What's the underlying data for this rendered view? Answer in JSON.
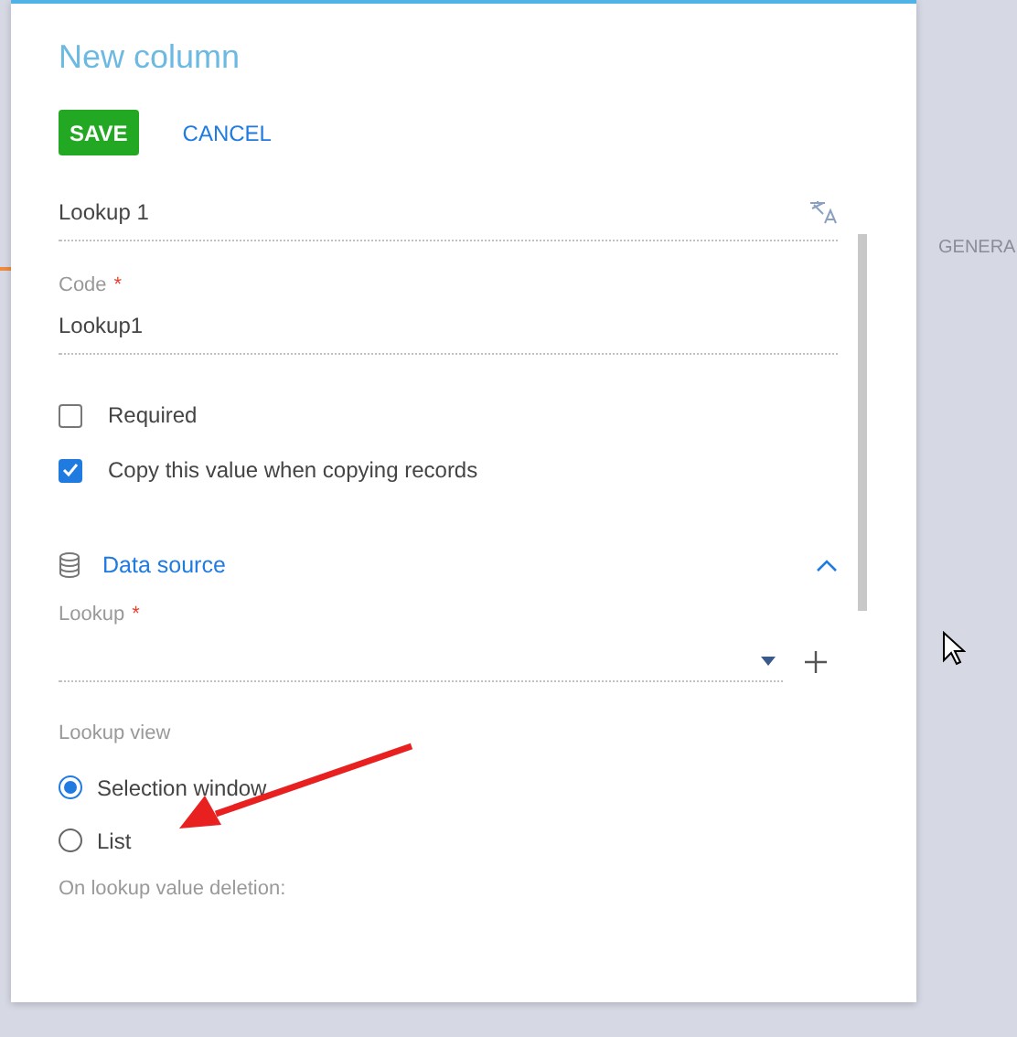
{
  "background_tabs": [
    {
      "label": "GENERA",
      "selected": false
    }
  ],
  "dialog": {
    "title": "New column",
    "buttons": [
      {
        "label": "SAVE",
        "kind": "primary"
      },
      {
        "label": "CANCEL",
        "kind": "link"
      }
    ],
    "fields": [
      {
        "value": "Lookup 1",
        "translatable": true
      },
      {
        "label": "Code",
        "required_mark": "*",
        "value": "Lookup1"
      }
    ],
    "checkboxes": [
      {
        "label": "Required",
        "checked": false
      },
      {
        "label": "Copy this value when copying records",
        "checked": true
      }
    ],
    "section": {
      "title": "Data source",
      "expanded": true
    },
    "lookup": {
      "label": "Lookup",
      "required_mark": "*"
    },
    "lookup_view": {
      "label": "Lookup view",
      "options": [
        {
          "label": "Selection window",
          "selected": true
        },
        {
          "label": "List",
          "selected": false
        }
      ]
    },
    "deletion_label": "On lookup value deletion:"
  }
}
